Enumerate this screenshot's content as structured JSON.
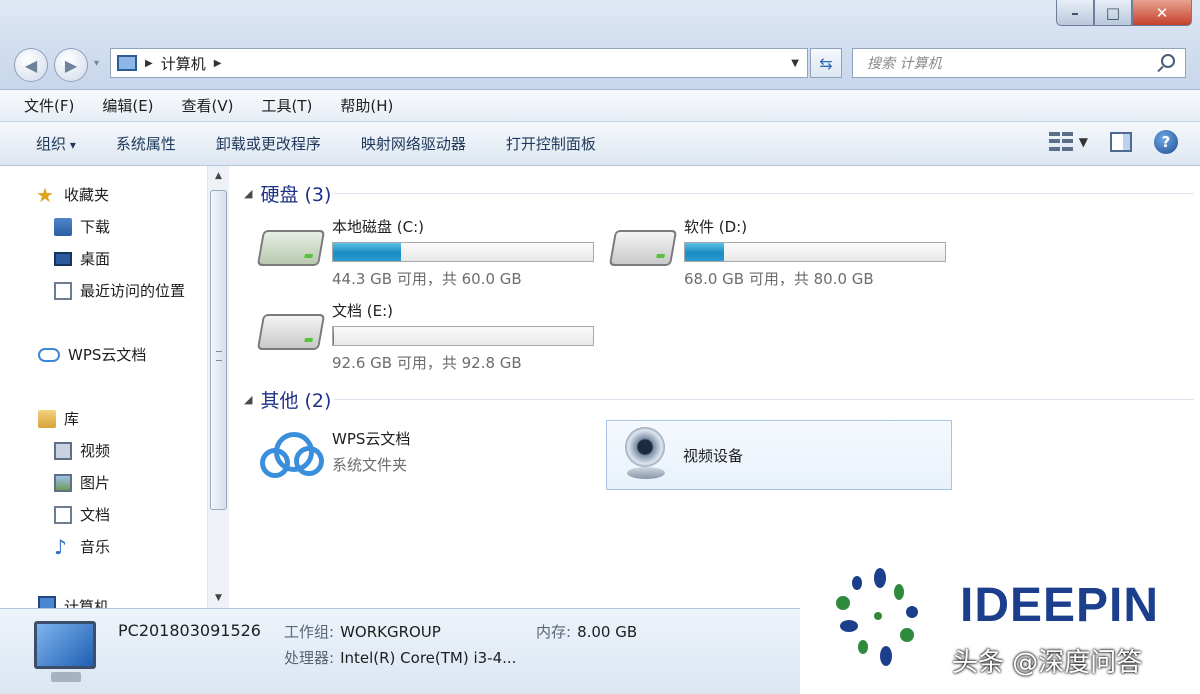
{
  "window": {
    "minimize": "–",
    "maximize": "□",
    "close": "✕"
  },
  "address": {
    "location": "计算机",
    "search_placeholder": "搜索 计算机"
  },
  "menu": [
    "文件(F)",
    "编辑(E)",
    "查看(V)",
    "工具(T)",
    "帮助(H)"
  ],
  "toolbar": {
    "organize": "组织",
    "items": [
      "系统属性",
      "卸载或更改程序",
      "映射网络驱动器",
      "打开控制面板"
    ]
  },
  "sidebar": {
    "favorites": "收藏夹",
    "downloads": "下载",
    "desktop": "桌面",
    "recent": "最近访问的位置",
    "wps": "WPS云文档",
    "libraries": "库",
    "videos": "视频",
    "pictures": "图片",
    "documents": "文档",
    "music": "音乐",
    "computer": "计算机"
  },
  "content": {
    "drives_group": "硬盘 (3)",
    "drives": [
      {
        "name": "本地磁盘 (C:)",
        "info": "44.3 GB 可用，共 60.0 GB",
        "used_fraction": 0.26
      },
      {
        "name": "软件 (D:)",
        "info": "68.0 GB 可用，共 80.0 GB",
        "used_fraction": 0.15
      },
      {
        "name": "文档 (E:)",
        "info": "92.6 GB 可用，共 92.8 GB",
        "used_fraction": 0.002
      }
    ],
    "other_group": "其他 (2)",
    "wps_name": "WPS云文档",
    "wps_type": "系统文件夹",
    "video_device": "视频设备"
  },
  "details": {
    "pc_name": "PC201803091526",
    "workgroup_label": "工作组:",
    "workgroup": "WORKGROUP",
    "memory_label": "内存:",
    "memory": "8.00 GB",
    "cpu_label": "处理器:",
    "cpu": "Intel(R) Core(TM) i3-4..."
  },
  "watermark": {
    "brand": "IDEEPIN",
    "credit": "头条 @深度问答"
  },
  "colors": {
    "accent": "#1e3287",
    "drive_fill": "#1b8bc3",
    "brand": "#1b3f8c"
  }
}
